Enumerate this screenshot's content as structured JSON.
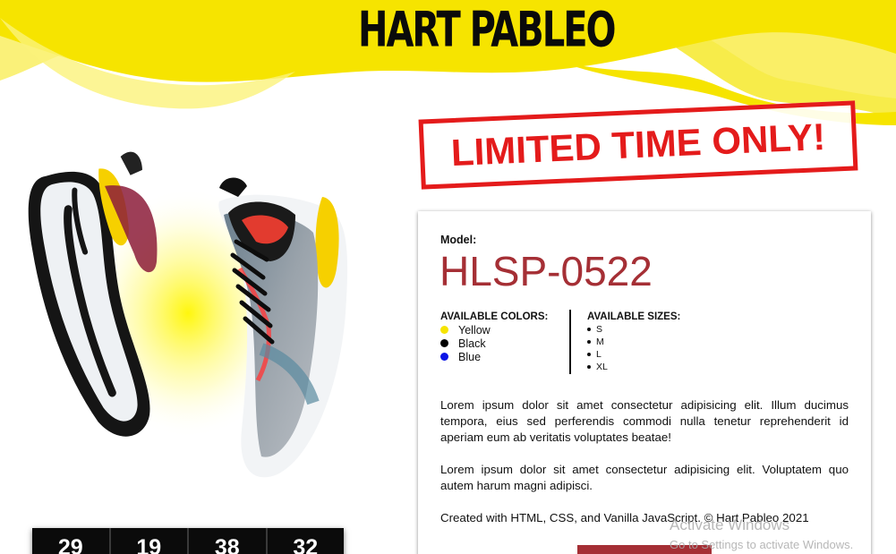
{
  "brand": {
    "logo_text": "HART PABLEO",
    "accent_yellow": "#f6e400",
    "accent_red": "#e41b1b",
    "model_color": "#a52f35"
  },
  "promo": {
    "banner_text": "LIMITED TIME ONLY!"
  },
  "product": {
    "image_icon": "sneaker-pair-image",
    "model_label": "Model:",
    "model_number": "HLSP-0522",
    "colors_title": "AVAILABLE COLORS:",
    "colors": [
      {
        "name": "Yellow",
        "hex": "#f6e400"
      },
      {
        "name": "Black",
        "hex": "#000000"
      },
      {
        "name": "Blue",
        "hex": "#0a14e6"
      }
    ],
    "sizes_title": "AVAILABLE SIZES:",
    "sizes": [
      "S",
      "M",
      "L",
      "XL"
    ],
    "description_1": "Lorem ipsum dolor sit amet consectetur adipisicing elit. Illum ducimus tempora, eius sed perferendis commodi nulla tenetur reprehenderit id aperiam eum ab veritatis voluptates beatae!",
    "description_2": "Lorem ipsum dolor sit amet consectetur adipisicing elit. Voluptatem quo autem harum magni adipisci.",
    "credit": "Created with HTML, CSS, and Vanilla JavaScript. © Hart Pableo 2021"
  },
  "countdown": {
    "values": [
      "29",
      "19",
      "38",
      "32"
    ]
  },
  "os_watermark": {
    "title": "Activate Windows",
    "subtitle": "Go to Settings to activate Windows."
  }
}
